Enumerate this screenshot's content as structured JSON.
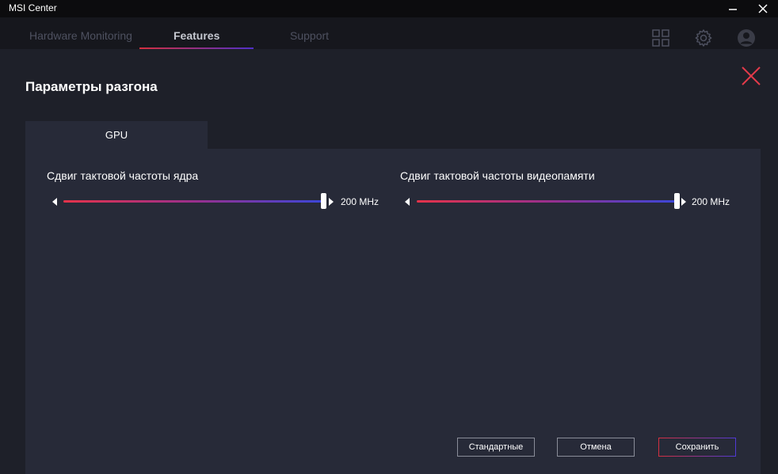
{
  "window": {
    "title": "MSI Center"
  },
  "nav": {
    "tabs": [
      {
        "label": "Hardware Monitoring",
        "active": false
      },
      {
        "label": "Features",
        "active": true
      },
      {
        "label": "Support",
        "active": false
      }
    ],
    "icons": [
      "grid-icon",
      "gear-icon",
      "user-avatar-icon"
    ]
  },
  "dialog": {
    "title": "Параметры разгона",
    "tab_label": "GPU",
    "sliders": [
      {
        "label": "Сдвиг тактовой частоты ядра",
        "value": "200 MHz",
        "position": 1.0
      },
      {
        "label": "Сдвиг тактовой частоты видеопамяти",
        "value": "200 MHz",
        "position": 1.0
      }
    ],
    "buttons": {
      "default_label": "Стандартные",
      "cancel_label": "Отмена",
      "save_label": "Сохранить"
    }
  },
  "colors": {
    "accent_red": "#e5334a",
    "accent_blue": "#3b46d8",
    "background": "#1e2029",
    "panel": "#272a38"
  }
}
